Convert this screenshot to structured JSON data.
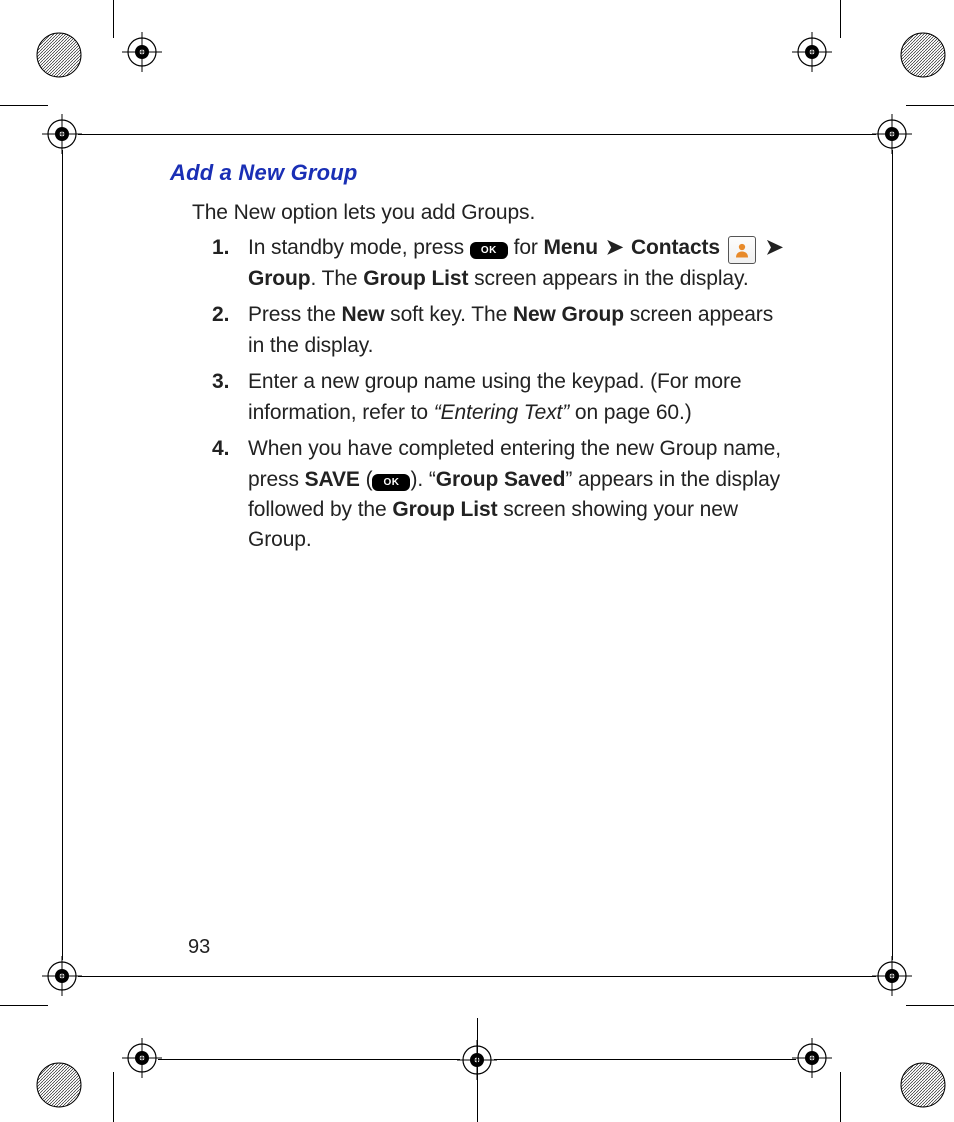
{
  "heading": "Add a New Group",
  "intro": "The New option lets you add Groups.",
  "page_number": "93",
  "ok_label": "OK",
  "arrow": "➤",
  "step1": {
    "t1": "In standby mode, press ",
    "for": " for ",
    "menu": "Menu",
    "contacts": "Contacts",
    "group": "Group",
    "period_the": ". The ",
    "group_list": "Group List",
    "tail": " screen appears in the display."
  },
  "step2": {
    "t1": "Press the ",
    "new": "New",
    "t2": " soft key. The ",
    "new_group": "New Group",
    "t3": " screen appears in the display."
  },
  "step3": {
    "t1": "Enter a new group name using the keypad. (For more information, refer to ",
    "ref": "“Entering Text”",
    "t2": " on page 60.)"
  },
  "step4": {
    "t1": "When you have completed entering the new Group name, press ",
    "save": "SAVE",
    "open_paren": " (",
    "close_paren": "). “",
    "group_saved": "Group Saved",
    "t2": "” appears in the display followed by the ",
    "group_list": "Group List",
    "t3": " screen showing your new Group."
  }
}
